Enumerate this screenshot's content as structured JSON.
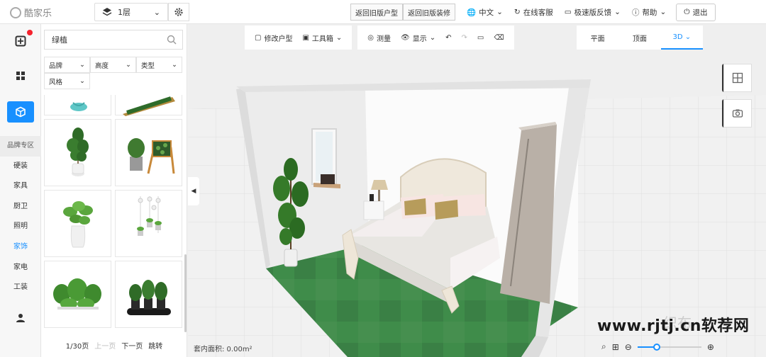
{
  "app": {
    "logo_text": "酷家乐"
  },
  "topbar": {
    "floor_label": "1层",
    "return_old_floorplan": "返回旧版户型",
    "return_old_decor": "返回旧版装修",
    "language": "中文",
    "online_service": "在线客服",
    "feedback": "极速版反馈",
    "help": "帮助",
    "logout": "退出"
  },
  "rail": {
    "categories": [
      "品牌专区",
      "硬装",
      "家具",
      "厨卫",
      "照明",
      "家饰",
      "家电",
      "工装"
    ],
    "active_category": "家饰",
    "accent": "#1890ff"
  },
  "panel": {
    "search_value": "绿植",
    "filters": [
      "品牌",
      "高度",
      "类型",
      "风格"
    ],
    "pager": {
      "current": "1/30页",
      "prev": "上一页",
      "next": "下一页",
      "jump": "跳转"
    }
  },
  "toolbar": {
    "edit_floorplan": "修改户型",
    "toolbox": "工具箱",
    "measure": "测量",
    "display": "显示",
    "view_tabs": [
      "平面",
      "顶面",
      "3D"
    ],
    "active_view": "3D"
  },
  "status": {
    "area": "套内面积: 0.00m²"
  },
  "zoom": {
    "level": 0.3
  },
  "watermark": {
    "text": "www.rjtj.cn软荐网",
    "ghost": "织布"
  }
}
